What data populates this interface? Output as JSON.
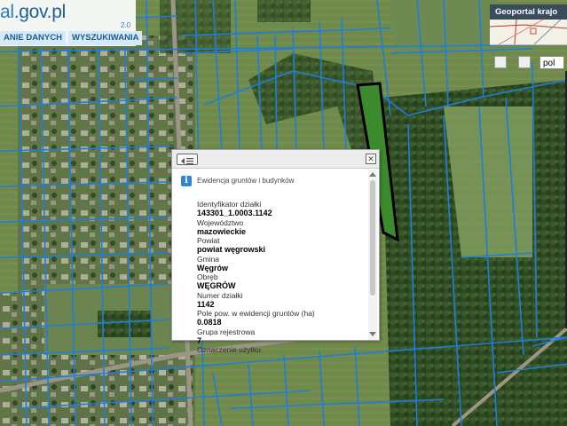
{
  "header": {
    "logo_prefix": "al",
    "logo_suffix": ".gov.pl",
    "logo_sub": "2.0"
  },
  "menu": {
    "items": [
      "ANIE DANYCH",
      "WYSZUKIWANIA"
    ]
  },
  "geoportal": {
    "title": "Geoportal krajo",
    "language": "pol"
  },
  "popup": {
    "title": "Ewidencja gruntów i budynków",
    "close_symbol": "✕",
    "fields": [
      {
        "label": "Identyfikator działki",
        "value": "143301_1.0003.1142"
      },
      {
        "label": "Województwo",
        "value": "mazowieckie"
      },
      {
        "label": "Powiat",
        "value": "powiat węgrowski"
      },
      {
        "label": "Gmina",
        "value": "Węgrów"
      },
      {
        "label": "Obręb",
        "value": "WĘGRÓW"
      },
      {
        "label": "Numer działki",
        "value": "1142"
      },
      {
        "label": "Pole pow. w ewidencji gruntów (ha)",
        "value": "0.0818"
      },
      {
        "label": "Grupa rejestrowa",
        "value": "7"
      },
      {
        "label": "Oznaczenie użytku",
        "value": ""
      }
    ]
  },
  "icons": [
    "info-icon",
    "back-icon",
    "close-icon",
    "print-icon",
    "map-icon"
  ],
  "colors": {
    "parcel_lines": "#1e7fd8",
    "selected_parcel": "#000000",
    "selected_fill": "#3c8a2e",
    "menu_text": "#1b5c92",
    "menu_bg": "#d6e9f8"
  }
}
